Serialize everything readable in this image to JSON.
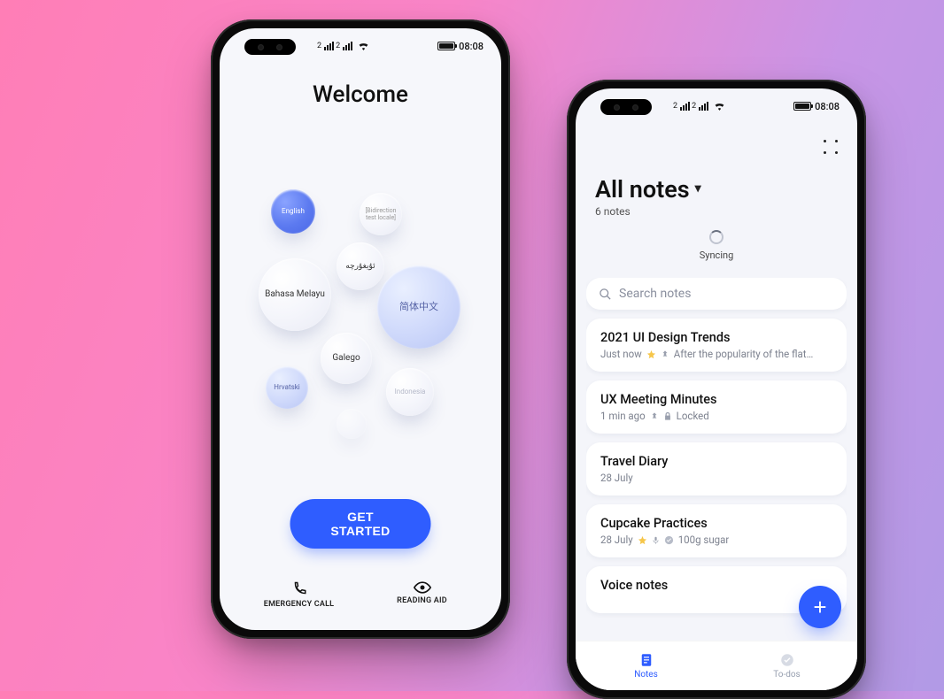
{
  "status": {
    "carrier": "2",
    "time": "08:08"
  },
  "welcome": {
    "title": "Welcome",
    "cta": "GET STARTED",
    "quick": {
      "emergency": "EMERGENCY CALL",
      "reading_aid": "READING AID"
    },
    "bubbles": {
      "english": "English",
      "bidirection": "[Bidirection test locale]",
      "uyghur": "ئۇيغۇرچە",
      "melayu": "Bahasa Melayu",
      "chinese": "简体中文",
      "galego": "Galego",
      "hrvatski": "Hrvatski",
      "indonesia": "Indonesia"
    }
  },
  "notes": {
    "header_title": "All notes",
    "count_text": "6 notes",
    "sync_text": "Syncing",
    "search_placeholder": "Search notes",
    "fab_label": "+",
    "tabs": {
      "notes": "Notes",
      "todos": "To-dos"
    },
    "items": [
      {
        "title": "2021 UI Design Trends",
        "time": "Just now",
        "starred": true,
        "pinned": true,
        "locked": false,
        "voice": false,
        "checked": false,
        "snippet": "After the popularity of the flat…"
      },
      {
        "title": "UX Meeting Minutes",
        "time": "1 min ago",
        "starred": false,
        "pinned": true,
        "locked": true,
        "voice": false,
        "checked": false,
        "lock_text": "Locked",
        "snippet": ""
      },
      {
        "title": "Travel Diary",
        "time": "28 July",
        "starred": false,
        "pinned": false,
        "locked": false,
        "voice": false,
        "checked": false,
        "snippet": ""
      },
      {
        "title": "Cupcake Practices",
        "time": "28 July",
        "starred": true,
        "pinned": false,
        "locked": false,
        "voice": true,
        "checked": true,
        "snippet": "100g sugar"
      },
      {
        "title": "Voice notes",
        "time": "",
        "starred": false,
        "pinned": false,
        "locked": false,
        "voice": false,
        "checked": false,
        "snippet": ""
      }
    ]
  }
}
